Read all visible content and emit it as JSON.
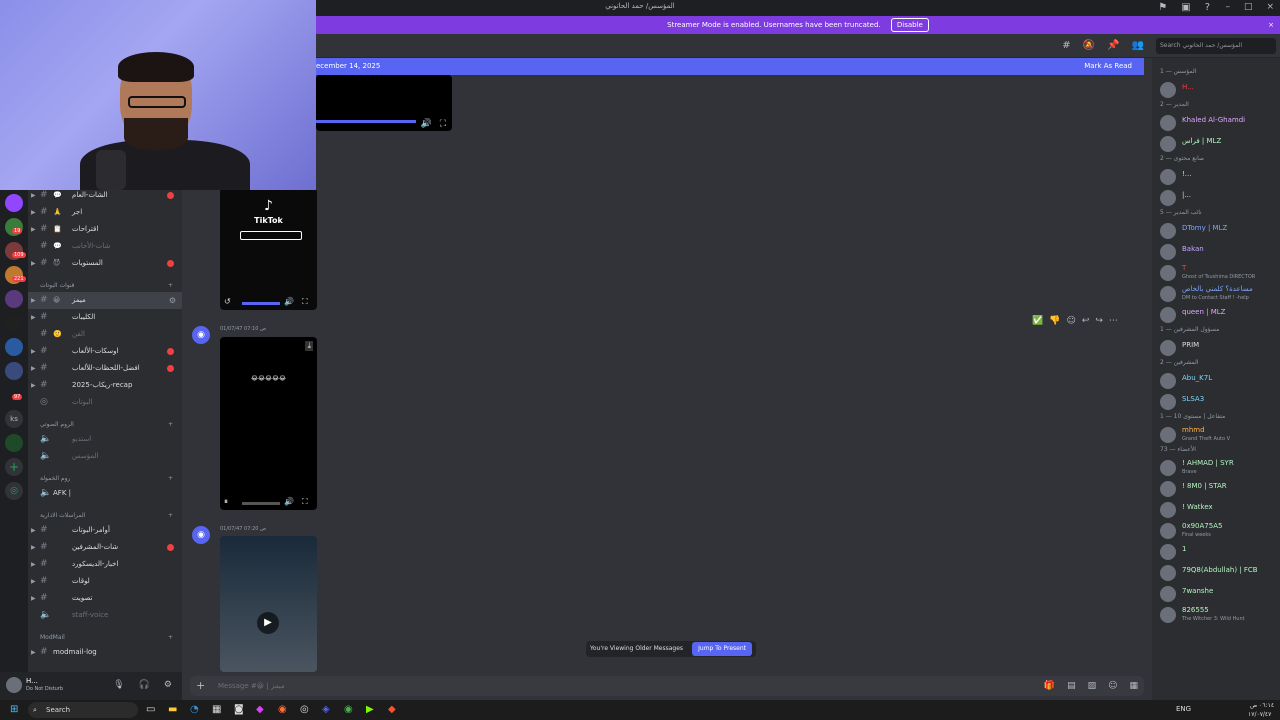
{
  "window": {
    "title": "المؤسس/ حمد الحاتوني"
  },
  "banner": {
    "text": "Streamer Mode is enabled. Usernames have been truncated.",
    "disable_label": "Disable"
  },
  "new_messages": {
    "date_text": "ecember 14, 2025",
    "mark_read": "Mark As Read"
  },
  "colors": {
    "accent": "#5865f2",
    "banner": "#7d3be0",
    "unread": "#f23f43",
    "online": "#23a55a"
  },
  "guild_badges": [
    "19",
    "109",
    "221",
    "97"
  ],
  "channels": [
    {
      "icon": "💬",
      "name": "الشات-العام",
      "muted": false,
      "unread": true
    },
    {
      "icon": "🙏",
      "name": "اجر",
      "muted": false,
      "unread": false
    },
    {
      "icon": "📋",
      "name": "اقتراحات",
      "muted": false,
      "unread": false
    },
    {
      "icon": "💬",
      "name": "شات-الأجانب",
      "muted": true,
      "unread": false
    },
    {
      "icon": "😈",
      "name": "المستويات",
      "muted": false,
      "unread": true
    }
  ],
  "cat_bots": "قنوات البوتات",
  "channels2": [
    {
      "icon": "😀",
      "name": "ميمز",
      "active": true
    },
    {
      "icon": "",
      "name": "الكليبات"
    },
    {
      "icon": "🙂",
      "name": "الفن",
      "muted": true
    },
    {
      "icon": "",
      "name": "اوسكات-الألعاب",
      "unread": true
    },
    {
      "icon": "",
      "name": "افضل-اللحظات-للألعاب",
      "unread": true
    },
    {
      "icon": "",
      "name": "2025-ريكاب-recap"
    },
    {
      "icon": "",
      "name": "البوتات",
      "muted": true
    }
  ],
  "cat_voice": "الروم الصوتي",
  "voice": [
    {
      "name": "استديو"
    },
    {
      "name": "المؤسس"
    }
  ],
  "cat_afk": "روم الخمولة",
  "afk": {
    "name": "AFK |"
  },
  "cat_admin": "المراسلات الادارية",
  "channels3": [
    {
      "icon": "",
      "name": "أوامر-البوتات"
    },
    {
      "icon": "",
      "name": "شات-المشرفين",
      "unread": true
    },
    {
      "icon": "",
      "name": "اخبار-الديسكورد"
    },
    {
      "icon": "",
      "name": "لوقات"
    },
    {
      "icon": "",
      "name": "تصويت"
    },
    {
      "icon": "",
      "name": "staff-voice",
      "muted": true
    }
  ],
  "cat_modmail": "ModMail",
  "modmail": {
    "name": "modmail-log"
  },
  "user": {
    "name": "H...",
    "status": "Do Not Disturb"
  },
  "messages": [
    {
      "time": "01/07/47 07:10 ص"
    },
    {
      "time": "01/07/47 07:20 ص"
    }
  ],
  "tiktok_label": "TikTok",
  "older_bar": {
    "text": "You're Viewing Older Messages",
    "jump": "Jump To Present"
  },
  "composer": {
    "placeholder": "Message #😀 | ميمز"
  },
  "search": {
    "placeholder": "Search المؤسس/ حمد الحاتوني"
  },
  "members": [
    {
      "type": "cat",
      "label": "المؤسس — 1"
    },
    {
      "type": "mem",
      "name": "H...",
      "color": "#f23f43"
    },
    {
      "type": "cat",
      "label": "المدير — 2"
    },
    {
      "type": "mem",
      "name": "Khaled Al-Ghamdi",
      "color": "#e0a6ff"
    },
    {
      "type": "mem",
      "name": "فراس | MLZ",
      "color": "#b5f5c0"
    },
    {
      "type": "cat",
      "label": "صانع محتوى — 2"
    },
    {
      "type": "mem",
      "name": "!...",
      "color": "#dbdee1"
    },
    {
      "type": "mem",
      "name": "|...",
      "color": "#dbdee1"
    },
    {
      "type": "cat",
      "label": "نائب المدير — 5"
    },
    {
      "type": "mem",
      "name": "DTomy | MLZ",
      "color": "#7aa6ff"
    },
    {
      "type": "mem",
      "name": "Bakan",
      "color": "#c8a6ff"
    },
    {
      "type": "mem",
      "name": "T",
      "color": "#f23f43",
      "sub": "Ghost of Tsushima DIRECTOR"
    },
    {
      "type": "mem",
      "name": "مساعدة؟ كلمني بالخاص",
      "color": "#7aa6ff",
      "sub": "DM to Contact Staff ! -help"
    },
    {
      "type": "mem",
      "name": "queen | MLZ",
      "color": "#e0a6ff"
    },
    {
      "type": "cat",
      "label": "مسؤول المشرفين — 1"
    },
    {
      "type": "mem",
      "name": "PRIM",
      "color": "#dbdee1"
    },
    {
      "type": "cat",
      "label": "المشرفين — 2"
    },
    {
      "type": "mem",
      "name": "Abu_K7L",
      "color": "#7ad6ff"
    },
    {
      "type": "mem",
      "name": "SLSA3",
      "color": "#7ad6ff"
    },
    {
      "type": "cat",
      "label": "متفاعل | مستوى 10 — 1"
    },
    {
      "type": "mem",
      "name": "mhmd",
      "color": "#ffb347",
      "sub": "Grand Theft Auto V"
    },
    {
      "type": "cat",
      "label": "الأعضاء — 73"
    },
    {
      "type": "mem",
      "name": "! AHMAD | SYR",
      "color": "#b5f5c0",
      "sub": "Brave"
    },
    {
      "type": "mem",
      "name": "! 8M0 | STAR",
      "color": "#b5f5c0"
    },
    {
      "type": "mem",
      "name": "! Watkex",
      "color": "#b5f5c0"
    },
    {
      "type": "mem",
      "name": "0x90A75A5",
      "color": "#b5f5c0",
      "sub": "Final weeks"
    },
    {
      "type": "mem",
      "name": "1",
      "color": "#b5f5c0"
    },
    {
      "type": "mem",
      "name": "79Q8(Abdullah) | FCB",
      "color": "#b5f5c0"
    },
    {
      "type": "mem",
      "name": "7wanshe",
      "color": "#b5f5c0"
    },
    {
      "type": "mem",
      "name": "826555",
      "color": "#b5f5c0",
      "sub": "The Witcher 3: Wild Hunt"
    }
  ],
  "taskbar": {
    "search": "Search",
    "lang": "ENG",
    "time": "٠٦:١٤ ص",
    "date": "١٧/٠٧/٤٧"
  }
}
